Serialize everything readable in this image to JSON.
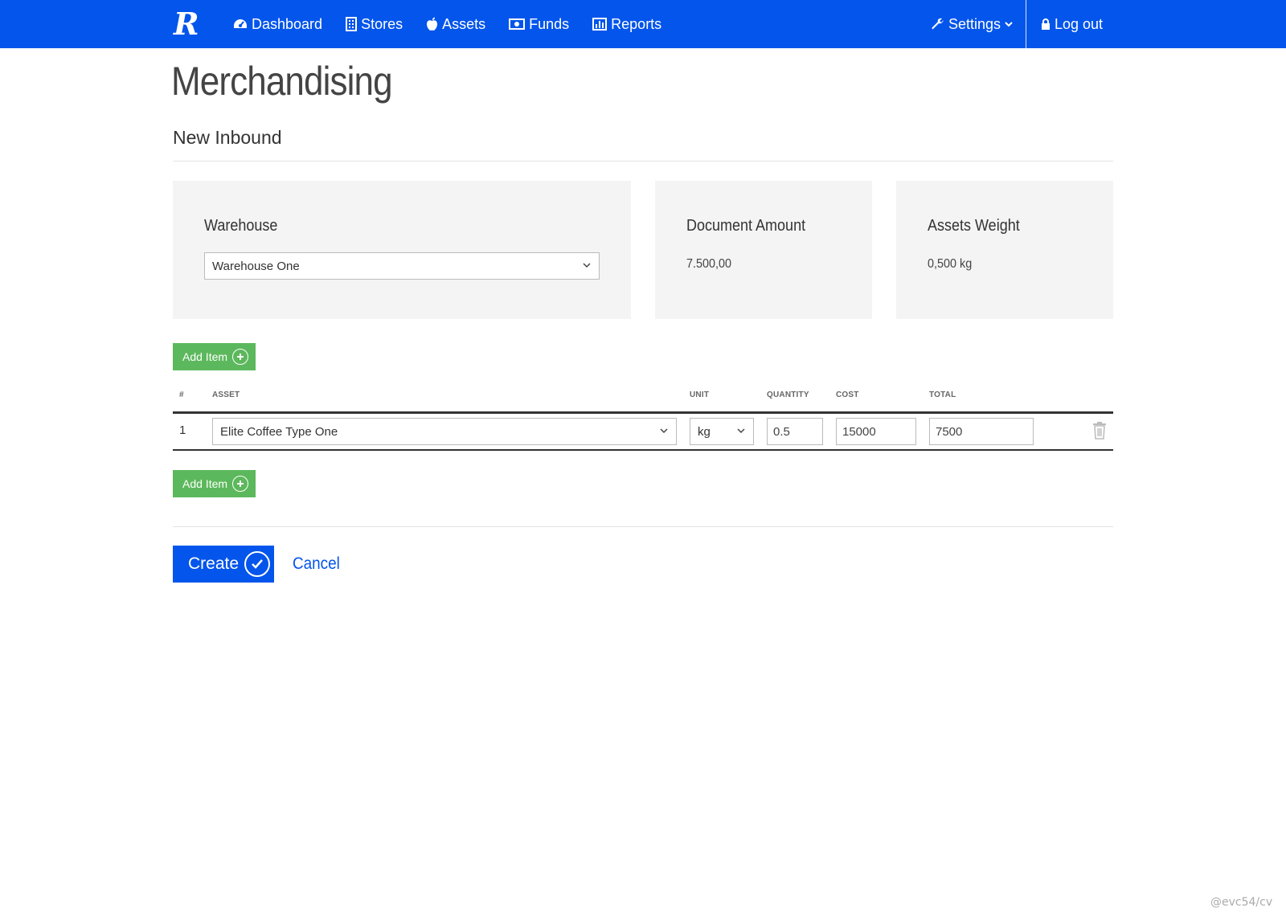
{
  "nav": {
    "brand": "R",
    "items": [
      {
        "label": "Dashboard",
        "icon": "dashboard-icon"
      },
      {
        "label": "Stores",
        "icon": "building-icon"
      },
      {
        "label": "Assets",
        "icon": "apple-icon"
      },
      {
        "label": "Funds",
        "icon": "money-icon"
      },
      {
        "label": "Reports",
        "icon": "bar-chart-icon"
      }
    ],
    "settings": "Settings",
    "logout": "Log out",
    "color": "#0355eb"
  },
  "page": {
    "title": "Merchandising",
    "subtitle": "New Inbound"
  },
  "panels": {
    "warehouse": {
      "label": "Warehouse",
      "selected": "Warehouse One"
    },
    "document_amount": {
      "label": "Document Amount",
      "value": "7.500,00"
    },
    "assets_weight": {
      "label": "Assets Weight",
      "value": "0,500 kg"
    }
  },
  "add_item_label": "Add Item",
  "table": {
    "headers": {
      "num": "#",
      "asset": "ASSET",
      "unit": "UNIT",
      "quantity": "QUANTITY",
      "cost": "COST",
      "total": "TOTAL"
    },
    "rows": [
      {
        "num": "1",
        "asset": "Elite Coffee Type One",
        "unit": "kg",
        "quantity": "0.5",
        "cost": "15000",
        "total": "7500"
      }
    ]
  },
  "actions": {
    "create": "Create",
    "cancel": "Cancel"
  },
  "watermark": "@evc54/cv",
  "colors": {
    "primary": "#0355eb",
    "success": "#5cb85c"
  }
}
